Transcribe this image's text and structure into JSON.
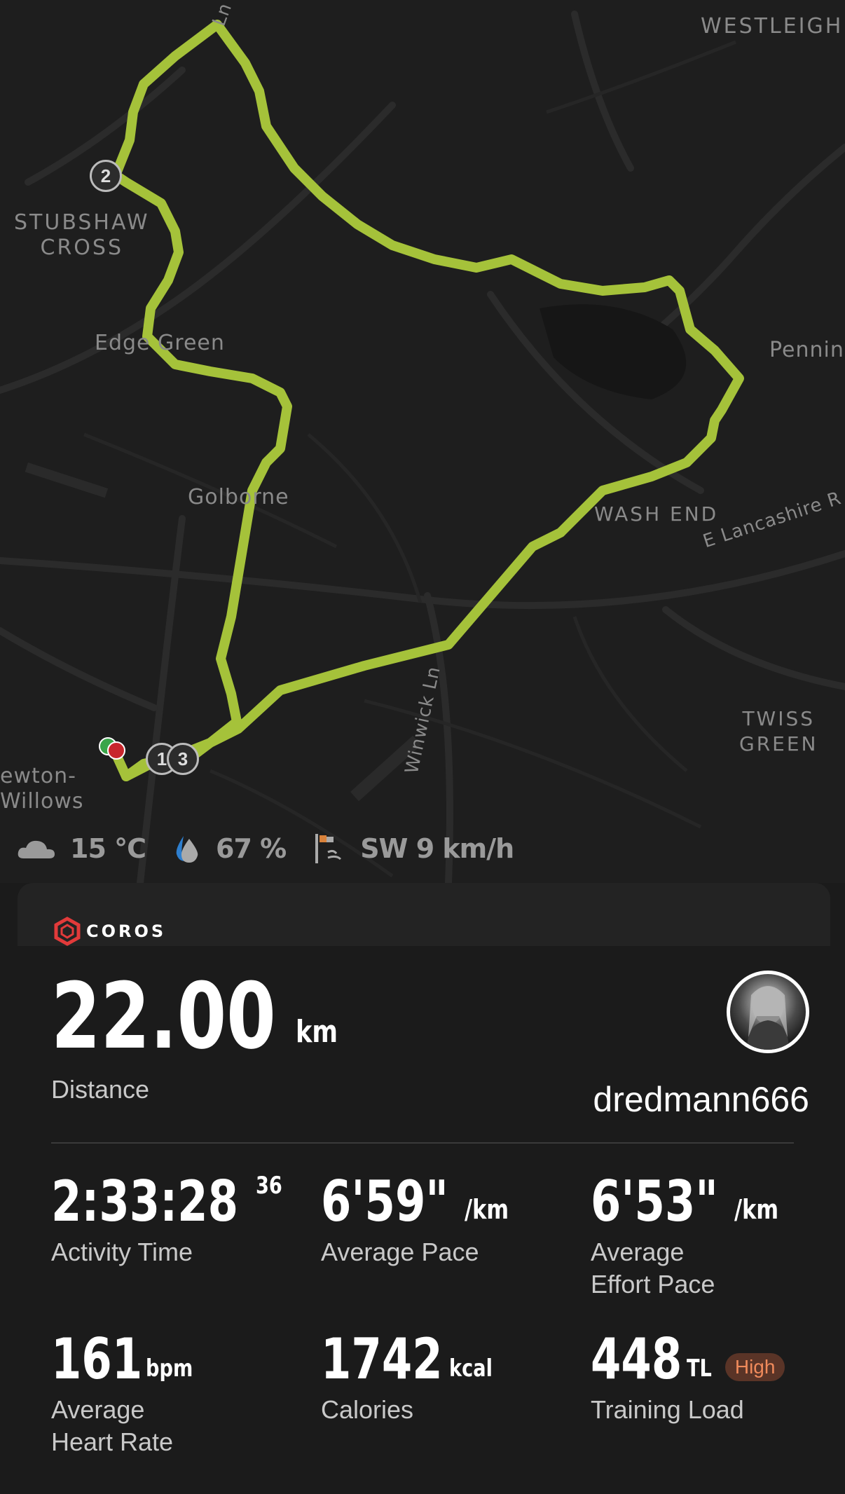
{
  "map": {
    "labels": {
      "westleigh": "WESTLEIGH",
      "stubshaw": "STUBSHAW\nCROSS",
      "edge_green": "Edge Green",
      "golborne": "Golborne",
      "wash_end": "WASH END",
      "e_lancashire": "E Lancashire R",
      "pennington": "Pennin",
      "twiss_green": "TWISS\nGREEN",
      "newton": "ewton-\nWillows",
      "winwick_ln": "Winwick Ln",
      "road_top": "Ln"
    },
    "markers": {
      "lap2": "2",
      "lap1": "1",
      "lap3": "3"
    },
    "route_color": "#a5c23a"
  },
  "weather": {
    "temperature": "15 °C",
    "humidity": "67 %",
    "wind": "SW 9 km/h",
    "icons": [
      "cloud-icon",
      "humidity-drop-icon",
      "wind-flag-icon"
    ]
  },
  "brand": {
    "name": "COROS",
    "color": "#e23a3a"
  },
  "summary": {
    "distance_value": "22.00",
    "distance_unit": "km",
    "distance_label": "Distance",
    "username": "dredmann666"
  },
  "stats": {
    "activity_time": {
      "value": "2:33:28",
      "sup": "36",
      "label": "Activity Time"
    },
    "avg_pace": {
      "value": "6'59\"",
      "unit": "/km",
      "label": "Average Pace"
    },
    "avg_effort_pace": {
      "value": "6'53\"",
      "unit": "/km",
      "label": "Average\nEffort Pace"
    },
    "avg_hr": {
      "value": "161",
      "unit": "bpm",
      "label": "Average\nHeart Rate"
    },
    "calories": {
      "value": "1742",
      "unit": "kcal",
      "label": "Calories"
    },
    "training_load": {
      "value": "448",
      "unit": "TL",
      "badge": "High",
      "label": "Training Load"
    }
  }
}
